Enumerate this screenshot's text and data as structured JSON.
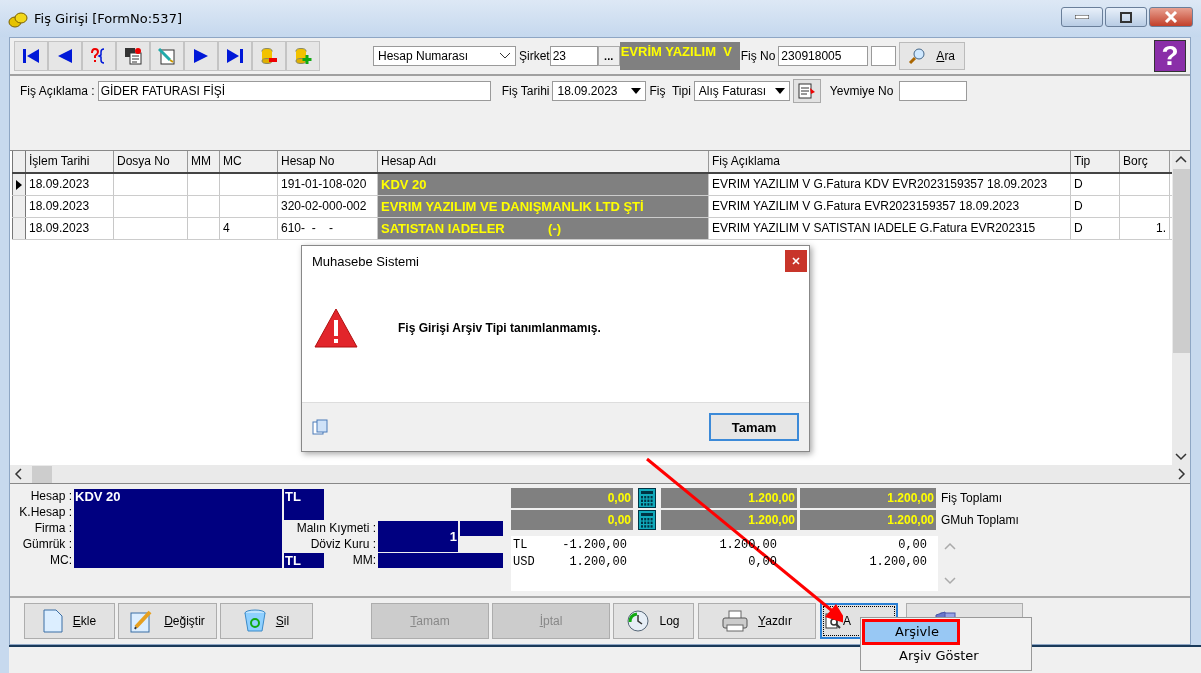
{
  "window": {
    "title": "Fiş Girişi [FormNo:537]"
  },
  "toolbar": {
    "lookup_select": "Hesap Numarası",
    "company_label": "Şirket",
    "company_code": "23",
    "browse_button": "...",
    "company_name": "EVRİM YAZILIM  V",
    "receipt_no_label": "Fiş No",
    "receipt_no": "230918005",
    "search_button": "Ara",
    "help_button": "?"
  },
  "header_form": {
    "description_label": "Fiş Açıklama :",
    "description": "GİDER FATURASI FİŞİ",
    "date_label": "Fiş Tarihi",
    "date": "18.09.2023",
    "type_label": "Fiş  Tipi",
    "type": "Alış Faturası",
    "journal_label": "Yevmiye No"
  },
  "table": {
    "columns": [
      "İşlem Tarihi",
      "Dosya No",
      "MM",
      "MC",
      "Hesap No",
      "Hesap Adı",
      "Fiş Açıklama",
      "Tip",
      "Borç"
    ],
    "rows": [
      {
        "selected": true,
        "cells": [
          "18.09.2023",
          "",
          "",
          "",
          "191-01-108-020",
          "KDV 20",
          "EVRIM YAZILIM V G.Fatura KDV EVR2023159357 18.09.2023",
          "D",
          ""
        ]
      },
      {
        "selected": false,
        "cells": [
          "18.09.2023",
          "",
          "",
          "",
          "320-02-000-002",
          "EVRIM YAZILIM VE DANIŞMANLIK LTD ŞTİ",
          "EVRIM YAZILIM V G.Fatura EVR2023159357 18.09.2023",
          "D",
          ""
        ]
      },
      {
        "selected": false,
        "cells": [
          "18.09.2023",
          "",
          "",
          "4",
          "610-  -    -",
          "SATISTAN IADELER            (-)",
          "EVRIM YAZILIM V SATISTAN IADELE G.Fatura EVR202315",
          "D",
          "1."
        ]
      }
    ]
  },
  "details": {
    "account_label": "Hesap :",
    "account": "KDV 20",
    "account_currency": "TL",
    "counter_account_label": "K.Hesap :",
    "firm_label": "Firma :",
    "customs_label": "Gümrük :",
    "mc_label": "MC:",
    "mc_currency": "TL",
    "goods_value_label": "Malın Kıymeti :",
    "exchange_rate_label": "Döviz Kuru :",
    "exchange_rate": "1",
    "mm_label": "MM:"
  },
  "totals": [
    {
      "label": "Fiş Toplamı",
      "values": [
        "0,00",
        "1.200,00",
        "1.200,00"
      ]
    },
    {
      "label": "GMuh Toplamı",
      "values": [
        "0,00",
        "1.200,00",
        "1.200,00"
      ]
    }
  ],
  "currency_summary": [
    {
      "currency": "TL",
      "values": [
        "-1.200,00",
        "1.200,00",
        "0,00"
      ]
    },
    {
      "currency": "USD",
      "values": [
        "1.200,00",
        "0,00",
        "1.200,00"
      ]
    }
  ],
  "buttons": [
    {
      "kind": "add",
      "label": "Ekle",
      "disabled": false,
      "mnemonic": true
    },
    {
      "kind": "edit",
      "label": "Değiştir",
      "disabled": false,
      "mnemonic": true
    },
    {
      "kind": "delete",
      "label": "Sil",
      "disabled": false,
      "mnemonic": true
    },
    {
      "kind": "plain",
      "label": "Tamam",
      "disabled": true,
      "mnemonic": true
    },
    {
      "kind": "plain",
      "label": "İptal",
      "disabled": true,
      "mnemonic": true
    },
    {
      "kind": "log",
      "label": "Log",
      "disabled": false,
      "mnemonic": false
    },
    {
      "kind": "print",
      "label": "Yazdır",
      "disabled": false,
      "mnemonic": true
    },
    {
      "kind": "archive",
      "label": "A",
      "disabled": false,
      "mnemonic": false,
      "focused": true
    },
    {
      "kind": "door",
      "disabled": false,
      "mnemonic": false
    }
  ],
  "dialog": {
    "title": "Muhasebe Sistemi",
    "message": "Fiş Girişi Arşiv Tipi tanımlanmamış.",
    "button": "Tamam"
  },
  "context_menu": {
    "items": [
      {
        "label": "Arşivle",
        "selected": true,
        "highlighted": true
      },
      {
        "label": "Arşiv Göster",
        "selected": false,
        "highlighted": false
      }
    ]
  }
}
